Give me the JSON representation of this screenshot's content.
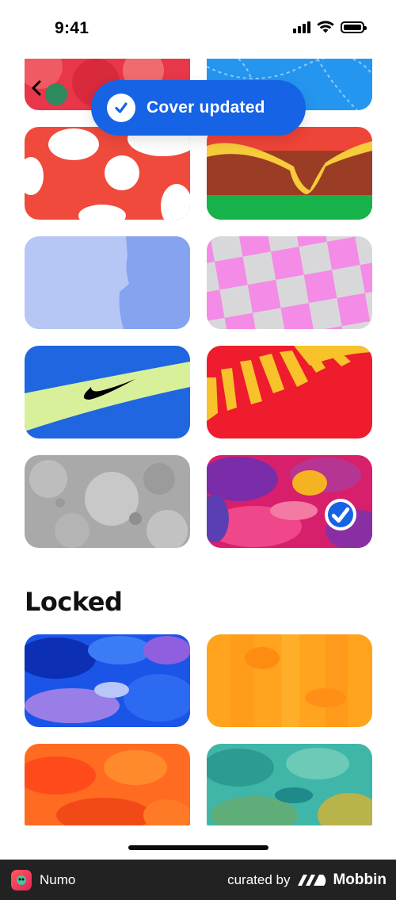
{
  "status_bar": {
    "time": "9:41"
  },
  "toast": {
    "text": "Cover updated"
  },
  "sections": {
    "locked_title": "Locked"
  },
  "colors": {
    "accent": "#1663e6",
    "footer_bg": "#222222"
  },
  "covers": {
    "selected": "pink-feathers",
    "available": [
      "red-watercolor",
      "blue-pattern",
      "red-mushroom",
      "burger",
      "periwinkle-abstract",
      "pink-checker",
      "blue-swoosh",
      "red-sun",
      "grey-moon",
      "pink-feathers"
    ],
    "locked": [
      "blue-paint",
      "orange-paint",
      "red-orange-paint",
      "teal-paint"
    ]
  },
  "footer": {
    "app_name": "Numo",
    "curated_by": "curated by",
    "brand": "Mobbin"
  }
}
